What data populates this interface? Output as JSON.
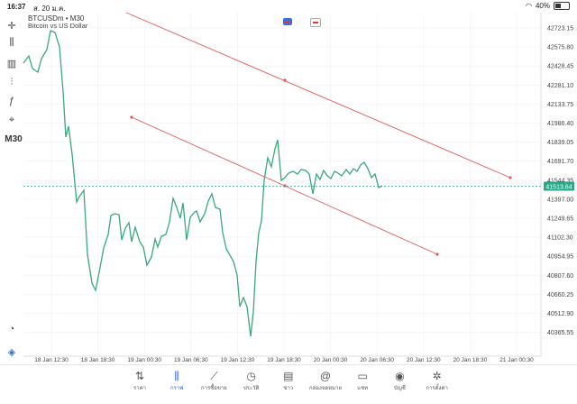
{
  "status_bar": {
    "time": "16:37",
    "date": "ส. 20 ม.ค.",
    "battery": "40%"
  },
  "chart": {
    "symbol": "BTCUSDm • M30",
    "description": "Bitcoin vs US Dollar",
    "timeframe_label": "M30",
    "current_price": "41513.64",
    "price_labels": [
      "42723.15",
      "42575.80",
      "42428.45",
      "42281.10",
      "42133.75",
      "41986.40",
      "41839.05",
      "41691.70",
      "41544.35",
      "41397.00",
      "41249.65",
      "41102.30",
      "40954.95",
      "40807.60",
      "40660.25",
      "40512.90",
      "40365.55"
    ],
    "time_labels": [
      "18 Jan 12:30",
      "18 Jan 18:30",
      "19 Jan 00:30",
      "19 Jan 06:30",
      "19 Jan 12:30",
      "19 Jan 18:30",
      "20 Jan 00:30",
      "20 Jan 06:30",
      "20 Jan 12:30",
      "20 Jan 18:30",
      "21 Jan 00:30"
    ],
    "colors": {
      "line": "#3aa87a",
      "trendline": "#e05a5a",
      "price_label_bg": "#2aa88a",
      "grid": "#f0f0f0"
    }
  },
  "left_toolbar": [
    {
      "icon": "crosshair-icon",
      "glyph": "✛"
    },
    {
      "icon": "candles-icon",
      "glyph": "⫼"
    },
    {
      "icon": "bars-icon",
      "glyph": "▥"
    },
    {
      "icon": "indicators-icon",
      "glyph": "⫶"
    },
    {
      "icon": "function-icon",
      "glyph": "ƒ"
    },
    {
      "icon": "objects-icon",
      "glyph": "⌖"
    }
  ],
  "tabs": [
    {
      "label": "ราคา",
      "icon": "quotes-icon",
      "glyph": "⇅"
    },
    {
      "label": "กราฟ",
      "icon": "chart-icon",
      "glyph": "⫼",
      "active": true
    },
    {
      "label": "การซื้อขาย",
      "icon": "trade-icon",
      "glyph": "⟋"
    },
    {
      "label": "ประวัติ",
      "icon": "history-icon",
      "glyph": "◷"
    },
    {
      "label": "ข่าว",
      "icon": "news-icon",
      "glyph": "▤"
    },
    {
      "label": "กล่องจดหมาย",
      "icon": "mailbox-icon",
      "glyph": "@"
    },
    {
      "label": "แชท",
      "icon": "chat-icon",
      "glyph": "▭"
    },
    {
      "label": "บัญชี",
      "icon": "account-icon",
      "glyph": "◉"
    },
    {
      "label": "การตั้งค่า",
      "icon": "settings-icon",
      "glyph": "✲"
    }
  ]
}
